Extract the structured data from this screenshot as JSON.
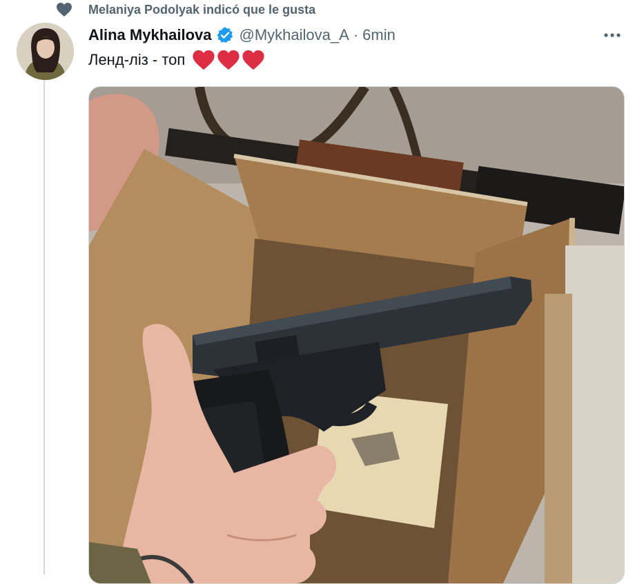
{
  "social_context": {
    "text": "Melaniya Podolyak indicó que le gusta",
    "icon": "heart-icon"
  },
  "tweet": {
    "author_name": "Alina Mykhailova",
    "verified": true,
    "handle": "@Mykhailova_A",
    "separator": "·",
    "time": "6min",
    "text": "Ленд-ліз - топ",
    "emoji": [
      "❤️",
      "❤️",
      "❤️"
    ],
    "more_icon": "more-icon",
    "media_label": "Photo of a pistol held over an open cardboard box"
  },
  "colors": {
    "heart": "#f91880",
    "emoji_heart": "#dd2e44",
    "verified": "#1d9bf0",
    "muted": "#536471"
  }
}
